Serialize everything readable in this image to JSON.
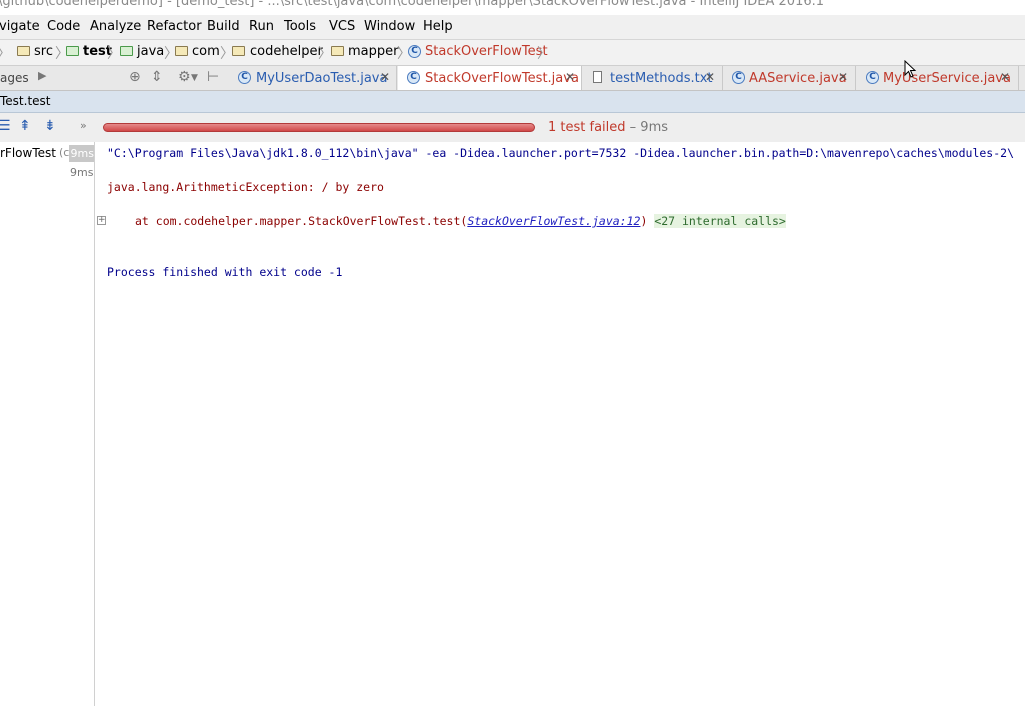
{
  "window": {
    "title": "\\github\\codehelperdemo] - [demo_test] - ...\\src\\test\\java\\com\\codehelper\\mapper\\StackOverFlowTest.java - IntelliJ IDEA 2016.1"
  },
  "menu": [
    "vigate",
    "Code",
    "Analyze",
    "Refactor",
    "Build",
    "Run",
    "Tools",
    "VCS",
    "Window",
    "Help"
  ],
  "breadcrumb": [
    "src",
    "test",
    "java",
    "com",
    "codehelper",
    "mapper",
    "StackOverFlowTest"
  ],
  "toolwindow": {
    "label": "ages"
  },
  "tabs": [
    {
      "label": "MyUserDaoTest.java",
      "color": "#2a5db0"
    },
    {
      "label": "StackOverFlowTest.java",
      "color": "#c0392b"
    },
    {
      "label": "testMethods.txt",
      "color": "#2a5db0"
    },
    {
      "label": "AAService.java",
      "color": "#c0392b"
    },
    {
      "label": "MyUserService.java",
      "color": "#c0392b"
    }
  ],
  "run": {
    "title": "Test.test",
    "status_failed": "1 test failed",
    "status_time": " – 9ms",
    "progress_fraction": 1.0
  },
  "tree": {
    "item_label": "rFlowTest",
    "item_suffix": "(c",
    "item_time_top": "9ms",
    "item_time": "9ms"
  },
  "console": {
    "command": "\"C:\\Program Files\\Java\\jdk1.8.0_112\\bin\\java\" -ea -Didea.launcher.port=7532 -Didea.launcher.bin.path=D:\\mavenrepo\\caches\\modules-2\\",
    "exception": "java.lang.ArithmeticException: / by zero",
    "stack_prefix": "at com.codehelper.mapper.StackOverFlowTest.test(",
    "stack_link": "StackOverFlowTest.java:12",
    "stack_suffix": ")",
    "internal_calls": "<27 internal calls>",
    "finished": "Process finished with exit code -1"
  },
  "colors": {
    "failed": "#c0392b",
    "link": "#2020c0",
    "console_text": "#00008b",
    "exception": "#8b0000"
  }
}
